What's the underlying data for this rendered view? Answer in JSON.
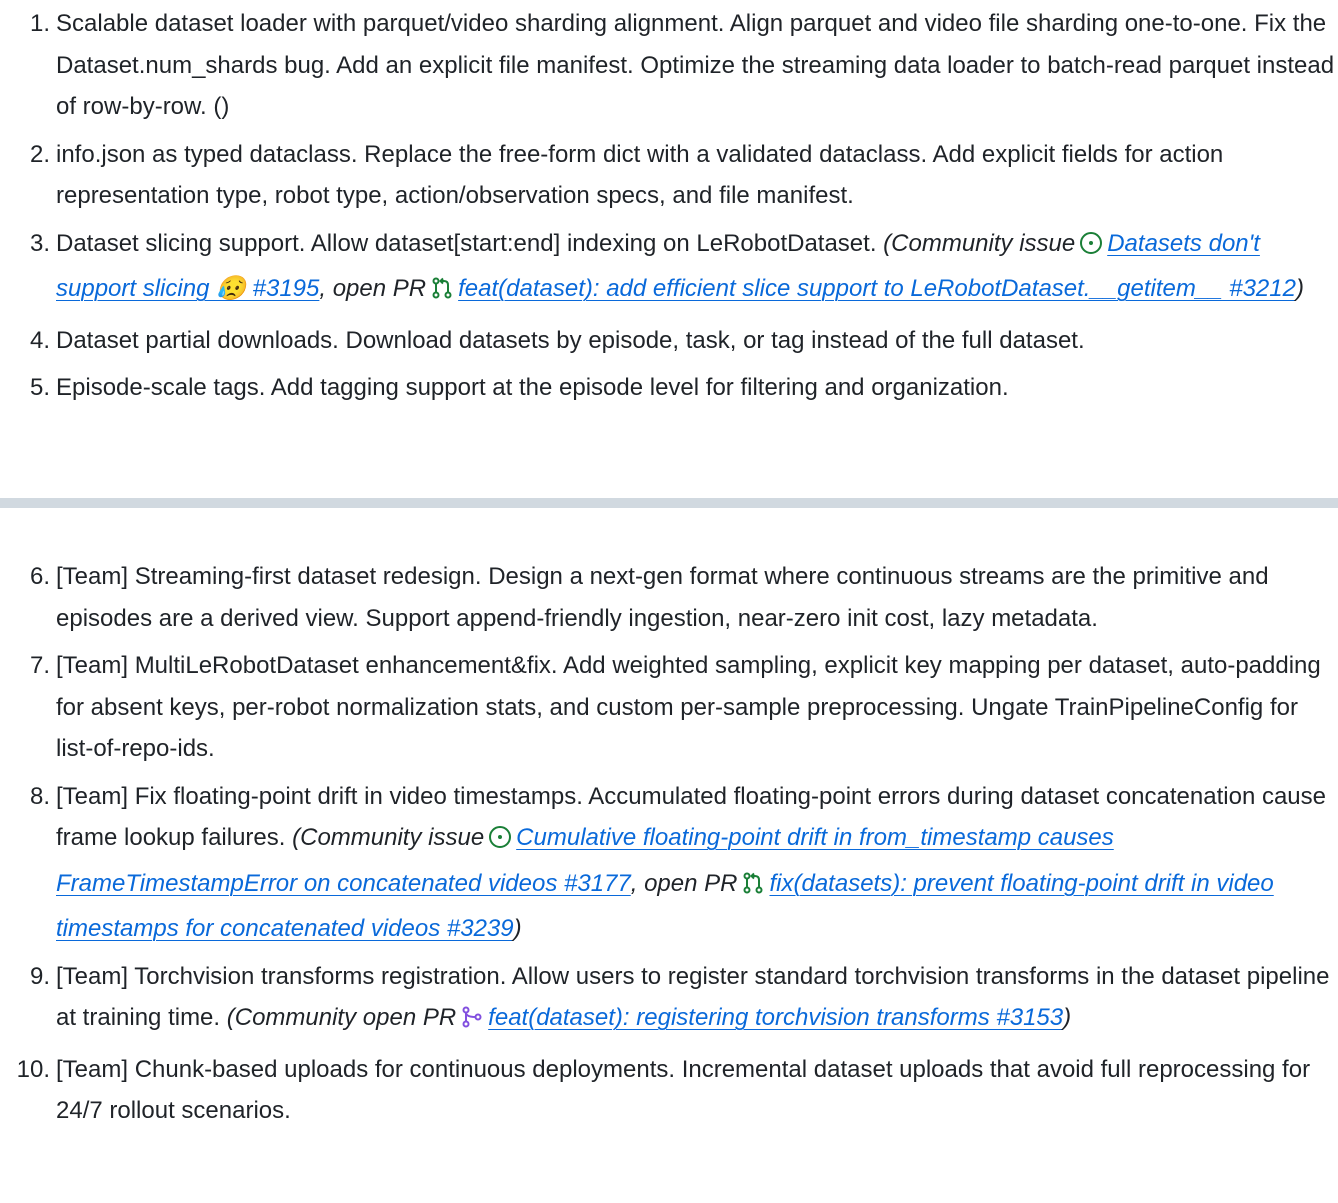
{
  "list_a": [
    {
      "num": "1.",
      "text": "Scalable dataset loader with parquet/video sharding alignment. Align parquet and video file sharding one-to-one. Fix the Dataset.num_shards bug. Add an explicit file manifest. Optimize the streaming data loader to batch-read parquet instead of row-by-row. ()"
    },
    {
      "num": "2.",
      "text": "info.json as typed dataclass. Replace the free-form dict with a validated dataclass. Add explicit fields for action representation type, robot type, action/observation specs, and file manifest."
    },
    {
      "num": "3.",
      "text": "Dataset slicing support. Allow dataset[start:end] indexing on LeRobotDataset.",
      "note_open": "(Community issue",
      "issue_link": "Datasets don't support slicing 😥 #3195",
      "note_mid": ", open PR",
      "pr_link": "feat(dataset): add efficient slice support to LeRobotDataset.__getitem__ #3212",
      "note_close": ")"
    },
    {
      "num": "4.",
      "text": "Dataset partial downloads. Download datasets by episode, task, or tag instead of the full dataset."
    },
    {
      "num": "5.",
      "text": "Episode-scale tags. Add tagging support at the episode level for filtering and organization."
    }
  ],
  "list_b": [
    {
      "num": "6.",
      "text": "[Team] Streaming-first dataset redesign. Design a next-gen format where continuous streams are the primitive and episodes are a derived view. Support append-friendly ingestion, near-zero init cost, lazy metadata."
    },
    {
      "num": "7.",
      "text": "[Team] MultiLeRobotDataset enhancement&fix. Add weighted sampling, explicit key mapping per dataset, auto-padding for absent keys, per-robot normalization stats, and custom per-sample preprocessing. Ungate TrainPipelineConfig for list-of-repo-ids."
    },
    {
      "num": "8.",
      "text": "[Team] Fix floating-point drift in video timestamps. Accumulated floating-point errors during dataset concatenation cause frame lookup failures.",
      "note_open": "(Community issue",
      "issue_link": "Cumulative floating-point drift in from_timestamp causes FrameTimestampError on concatenated videos #3177",
      "note_mid": ", open PR",
      "pr_link": "fix(datasets): prevent floating-point drift in video timestamps for concatenated videos #3239",
      "note_close": ")"
    },
    {
      "num": "9.",
      "text": "[Team] Torchvision transforms registration. Allow users to register standard torchvision transforms in the dataset pipeline at training time.",
      "note_open": "(Community open PR",
      "pr_link": "feat(dataset): registering torchvision transforms #3153",
      "note_close": ")"
    },
    {
      "num": "10.",
      "text": "[Team] Chunk-based uploads for continuous deployments. Incremental dataset uploads that avoid full reprocessing for 24/7 rollout scenarios."
    }
  ],
  "colors": {
    "text": "#1f2328",
    "link": "#0969da",
    "issue_open": "#1a7f37",
    "pr_open": "#1a7f37",
    "pr_draft_or_merged": "#8250df",
    "divider": "#d1d9e0"
  },
  "icons": {
    "issue": "issue-opened-icon",
    "pr": "git-pull-request-icon",
    "pr_purple": "git-merge-icon"
  }
}
